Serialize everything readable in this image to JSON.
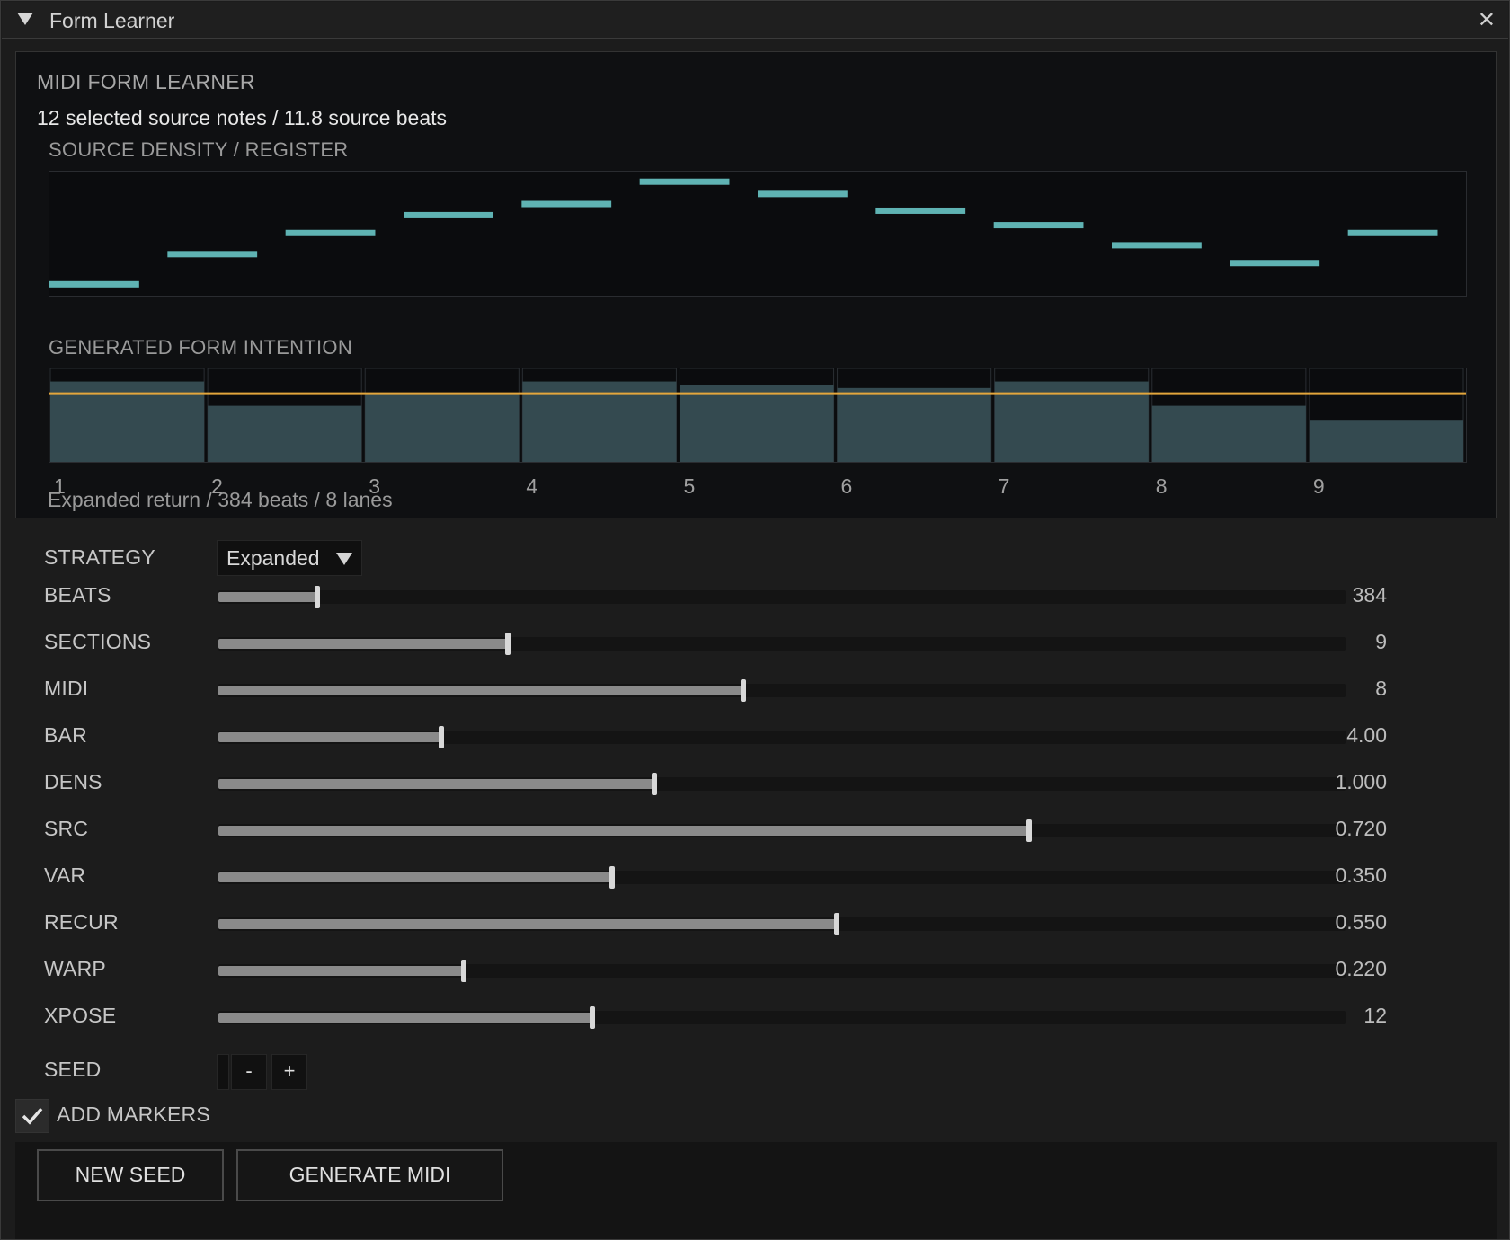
{
  "window": {
    "title": "Form Learner"
  },
  "panel": {
    "heading": "MIDI FORM LEARNER",
    "summary": "12 selected source notes / 11.8 source beats",
    "density_label": "SOURCE DENSITY / REGISTER",
    "intention_label": "GENERATED FORM INTENTION",
    "status": "Expanded return / 384 beats / 8 lanes"
  },
  "colors": {
    "density": "#5fb3b3",
    "section_fill": "#344a50",
    "intention_line": "#e3a63c"
  },
  "chart_data": [
    {
      "type": "bar",
      "title": "SOURCE DENSITY / REGISTER",
      "note": "12 source notes shown as horizontal segments; relative pitch height 0–1",
      "values": [
        0.05,
        0.32,
        0.51,
        0.67,
        0.77,
        0.97,
        0.86,
        0.71,
        0.58,
        0.4,
        0.24,
        0.51
      ]
    },
    {
      "type": "bar",
      "title": "GENERATED FORM INTENTION",
      "categories": [
        "1",
        "2",
        "3",
        "4",
        "5",
        "6",
        "7",
        "8",
        "9"
      ],
      "values": [
        0.86,
        0.6,
        0.72,
        0.86,
        0.82,
        0.79,
        0.86,
        0.6,
        0.45
      ],
      "line_value": 0.73,
      "ylim": [
        0,
        1
      ]
    }
  ],
  "controls": {
    "strategy": {
      "label": "STRATEGY",
      "value": "Expanded"
    },
    "sliders": [
      {
        "label": "BEATS",
        "value": "384",
        "fraction": 0.088
      },
      {
        "label": "SECTIONS",
        "value": "9",
        "fraction": 0.257
      },
      {
        "label": "MIDI",
        "value": "8",
        "fraction": 0.466
      },
      {
        "label": "BAR",
        "value": "4.00",
        "fraction": 0.198
      },
      {
        "label": "DENS",
        "value": "1.000",
        "fraction": 0.387
      },
      {
        "label": "SRC",
        "value": "0.720",
        "fraction": 0.719
      },
      {
        "label": "VAR",
        "value": "0.350",
        "fraction": 0.349
      },
      {
        "label": "RECUR",
        "value": "0.550",
        "fraction": 0.549
      },
      {
        "label": "WARP",
        "value": "0.220",
        "fraction": 0.218
      },
      {
        "label": "XPOSE",
        "value": "12",
        "fraction": 0.332
      }
    ],
    "seed": {
      "label": "SEED",
      "minus": "-",
      "plus": "+"
    },
    "markers": {
      "label": "ADD MARKERS",
      "checked": true
    }
  },
  "buttons": {
    "new_seed": "NEW SEED",
    "generate": "GENERATE MIDI"
  }
}
